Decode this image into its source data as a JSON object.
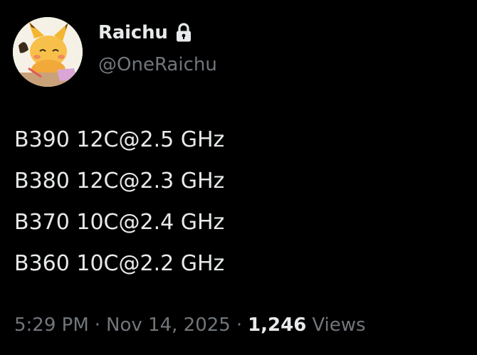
{
  "author": {
    "display_name": "Raichu",
    "handle": "@OneRaichu",
    "protected_icon": "lock-icon",
    "avatar_icon": "raichu-avatar"
  },
  "tweet": {
    "lines": [
      "B390 12C@2.5 GHz",
      "B380 12C@2.3 GHz",
      "B370 10C@2.4 GHz",
      "B360 10C@2.2 GHz"
    ]
  },
  "meta": {
    "time": "5:29 PM",
    "separator": "·",
    "date": "Nov 14, 2025",
    "views_count": "1,246",
    "views_label": "Views"
  },
  "colors": {
    "background": "#000000",
    "primary_text": "#e7e9ea",
    "secondary_text": "#71767b"
  }
}
